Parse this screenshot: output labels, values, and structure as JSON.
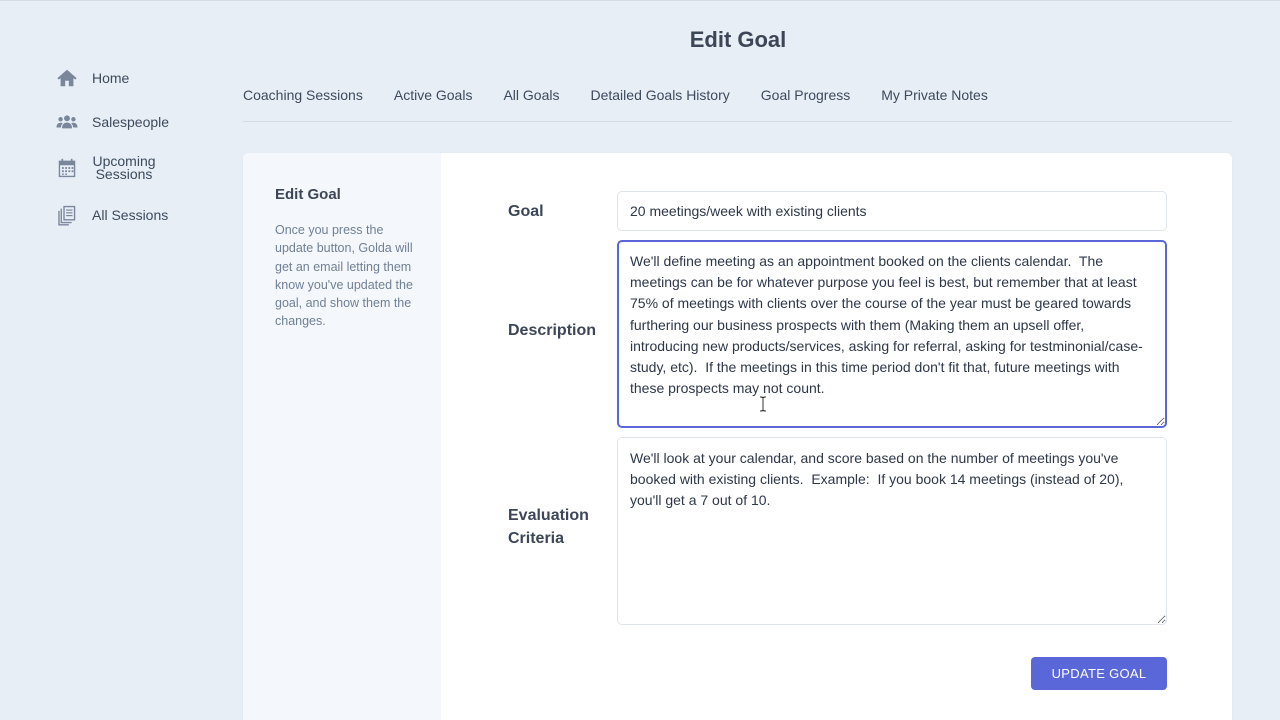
{
  "page": {
    "title": "Edit Goal"
  },
  "sidebar": {
    "items": [
      {
        "label": "Home",
        "icon": "home-icon"
      },
      {
        "label": "Salespeople",
        "icon": "users-icon"
      },
      {
        "label": "Upcoming Sessions",
        "icon": "calendar-icon"
      },
      {
        "label": "All Sessions",
        "icon": "documents-icon"
      }
    ]
  },
  "tabs": [
    {
      "label": "Coaching Sessions"
    },
    {
      "label": "Active Goals"
    },
    {
      "label": "All Goals"
    },
    {
      "label": "Detailed Goals History"
    },
    {
      "label": "Goal Progress"
    },
    {
      "label": "My Private Notes"
    }
  ],
  "panel": {
    "heading": "Edit Goal",
    "help": "Once you press the update button, Golda will get an email letting them know you've updated the goal, and show them the changes."
  },
  "form": {
    "goal_label": "Goal",
    "goal_value": "20 meetings/week with existing clients",
    "description_label": "Description",
    "description_value": "We'll define meeting as an appointment booked on the clients calendar.  The meetings can be for whatever purpose you feel is best, but remember that at least 75% of meetings with clients over the course of the year must be geared towards furthering our business prospects with them (Making them an upsell offer, introducing new products/services, asking for referral, asking for testminonial/case-study, etc).  If the meetings in this time period don't fit that, future meetings with these prospects may not count.",
    "evaluation_label": "Evaluation Criteria",
    "evaluation_value": "We'll look at your calendar, and score based on the number of meetings you've booked with existing clients.  Example:  If you book 14 meetings (instead of 20), you'll get a 7 out of 10.",
    "submit_label": "UPDATE GOAL"
  },
  "colors": {
    "background": "#e8eef6",
    "accent": "#5a67d8",
    "panel_left": "#f4f7fb"
  }
}
